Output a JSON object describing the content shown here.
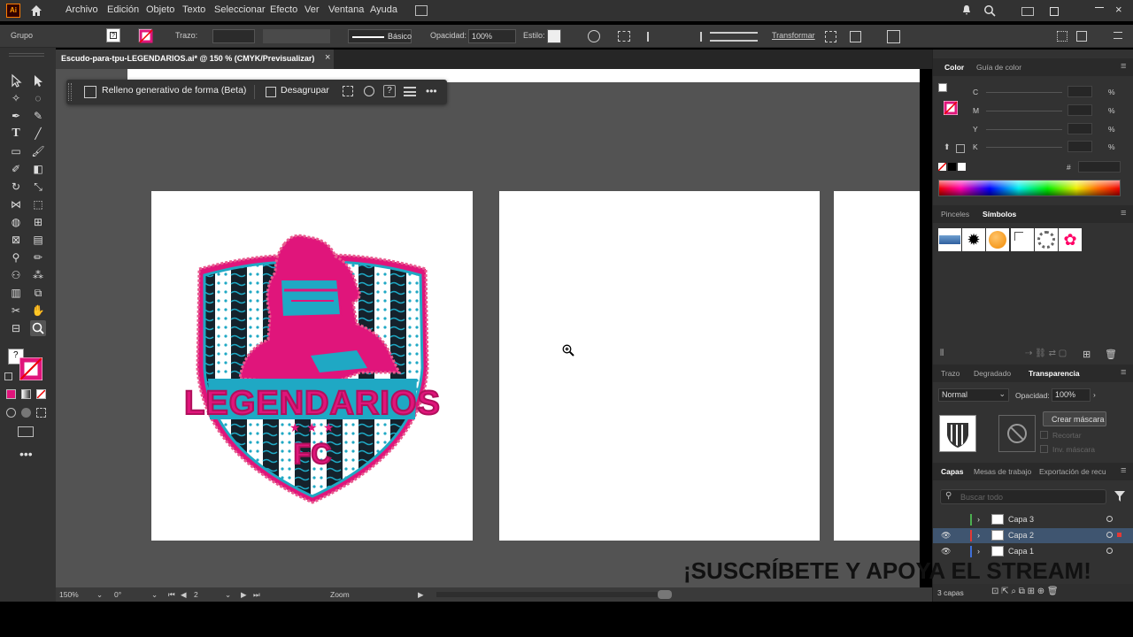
{
  "app": {
    "logo": "Ai",
    "menu": [
      "Archivo",
      "Edición",
      "Objeto",
      "Texto",
      "Seleccionar",
      "Efecto",
      "Ver",
      "Ventana",
      "Ayuda"
    ]
  },
  "control_bar": {
    "selection_type": "Grupo",
    "stroke_label": "Trazo:",
    "brush_label": "Básico",
    "opacity_label": "Opacidad:",
    "opacity_value": "100%",
    "style_label": "Estilo:",
    "transform_label": "Transformar"
  },
  "document": {
    "tab_title": "Escudo-para-tpu-LEGENDARIOS.ai* @ 150 % (CMYK/Previsualizar)",
    "close": "×"
  },
  "context_bar": {
    "generative_fill": "Relleno generativo de forma (Beta)",
    "ungroup": "Desagrupar",
    "help": "?"
  },
  "artwork": {
    "team_name": "LEGENDARIOS",
    "initials": "FC"
  },
  "status_bar": {
    "zoom": "150%",
    "rotation": "0°",
    "artboard": "2",
    "tool": "Zoom"
  },
  "panels": {
    "color": {
      "tabs": [
        "Color",
        "Guía de color"
      ],
      "channels": [
        {
          "label": "C",
          "unit": "%"
        },
        {
          "label": "M",
          "unit": "%"
        },
        {
          "label": "Y",
          "unit": "%"
        },
        {
          "label": "K",
          "unit": "%"
        }
      ],
      "hex_label": "#",
      "fill_color": "#e0157b"
    },
    "brushes": {
      "tabs": [
        "Pinceles",
        "Símbolos"
      ]
    },
    "transparency": {
      "tabs": [
        "Trazo",
        "Degradado",
        "Transparencia"
      ],
      "blend_mode": "Normal",
      "opacity_label": "Opacidad:",
      "opacity_value": "100%",
      "make_mask": "Crear máscara",
      "clip": "Recortar",
      "invert": "Inv. máscara"
    },
    "layers": {
      "tabs": [
        "Capas",
        "Mesas de trabajo",
        "Exportación de recu"
      ],
      "search_placeholder": "Buscar todo",
      "items": [
        {
          "name": "Capa 3",
          "color": "#4caf50"
        },
        {
          "name": "Capa 2",
          "color": "#e53935"
        },
        {
          "name": "Capa 1",
          "color": "#3f6fd8"
        }
      ],
      "count": "3 capas"
    }
  },
  "overlay": {
    "promo": "¡SUSCRÍBETE Y APOYA EL STREAM!"
  },
  "colors": {
    "brand_pink": "#e0157b",
    "teal": "#1fa8c4",
    "ui_dark": "#323232",
    "canvas_gray": "#535353"
  }
}
